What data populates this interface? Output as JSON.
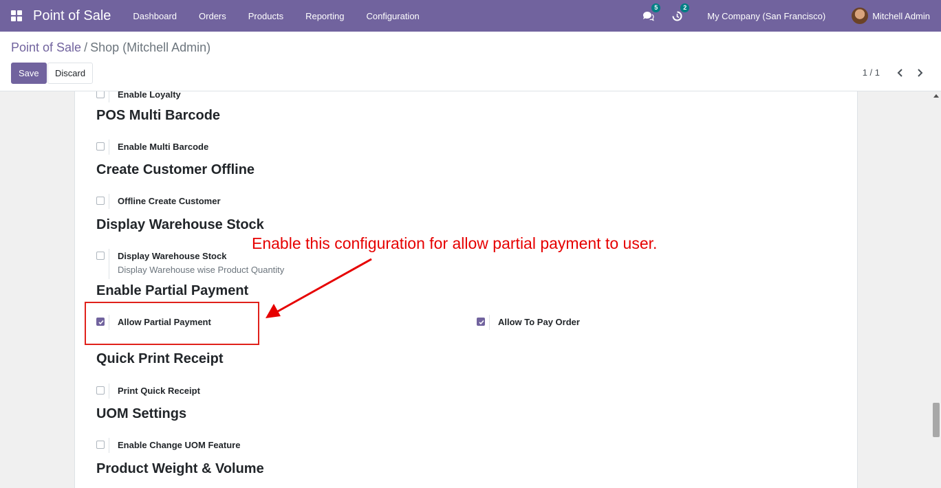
{
  "navbar": {
    "app_name": "Point of Sale",
    "menu": [
      "Dashboard",
      "Orders",
      "Products",
      "Reporting",
      "Configuration"
    ],
    "messages_count": "5",
    "activities_count": "2",
    "company": "My Company (San Francisco)",
    "user": "Mitchell Admin"
  },
  "breadcrumb": {
    "parent": "Point of Sale",
    "separator": "/",
    "current": "Shop (Mitchell Admin)"
  },
  "buttons": {
    "save": "Save",
    "discard": "Discard"
  },
  "pager": "1 / 1",
  "sections": {
    "loyalty": {
      "label": "Enable Loyalty",
      "checked": false
    },
    "multi_barcode": {
      "title": "POS Multi Barcode",
      "label": "Enable Multi Barcode",
      "checked": false
    },
    "customer_offline": {
      "title": "Create Customer Offline",
      "label": "Offline Create Customer",
      "checked": false
    },
    "warehouse_stock": {
      "title": "Display Warehouse Stock",
      "label": "Display Warehouse Stock",
      "desc": "Display Warehouse wise Product Quantity",
      "checked": false
    },
    "partial_payment": {
      "title": "Enable Partial Payment",
      "label": "Allow Partial Payment",
      "checked": true,
      "label2": "Allow To Pay Order",
      "checked2": true
    },
    "quick_print": {
      "title": "Quick Print Receipt",
      "label": "Print Quick Receipt",
      "checked": false
    },
    "uom": {
      "title": "UOM Settings",
      "label": "Enable Change UOM Feature",
      "checked": false
    },
    "weight_volume": {
      "title": "Product Weight & Volume"
    }
  },
  "annotation": "Enable this configuration for allow partial payment to user.",
  "colors": {
    "brand": "#71639e",
    "annotation": "#e60000"
  }
}
